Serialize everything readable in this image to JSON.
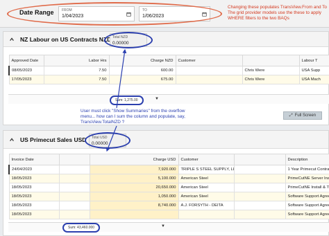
{
  "date_range": {
    "title": "Date Range",
    "from": {
      "label": "FROM",
      "value": "1/04/2023"
    },
    "to": {
      "label": "TO",
      "value": "1/06/2023"
    }
  },
  "annotations": {
    "red_note": "Changing these populates TransView.From and To\nThe grid provider models use the these to apply WHERE filters to the two BAQs",
    "blue_note": "User must click \"Show Summaries\" from the overflow menu... how can I sum the column and populate, say, TransView.TotalNZD ?"
  },
  "panel1": {
    "title": "NZ Labour on US Contracts NZD",
    "total_label": "Total NZD",
    "total_value": "0.00000",
    "columns": [
      "Approved Date",
      "Labor Hrs",
      "Charge NZD",
      "Customer",
      "",
      "Labour T"
    ],
    "rows": [
      {
        "date": "08/05/2023",
        "hrs": "7.50",
        "charge": "600.00",
        "customer": "Chris Were",
        "labour": "USA Supp"
      },
      {
        "date": "17/05/2023",
        "hrs": "7.50",
        "charge": "675.00",
        "customer": "Chris Were",
        "labour": "USA Mach"
      }
    ],
    "sum_label": "Sum: 1,275.00",
    "fullscreen_label": "Full Screen"
  },
  "panel2": {
    "title": "US Primecut Sales USD",
    "total_label": "Total USD",
    "total_value": "0.00000",
    "columns": [
      "Invoice Date",
      "",
      "Charge USD",
      "Customer",
      "",
      "Description"
    ],
    "rows": [
      {
        "date": "24/04/2023",
        "charge": "7,920.000",
        "customer": "TRIPLE S STEEL SUPPLY, LLC",
        "desc": "1 Year Primecut Contract"
      },
      {
        "date": "18/05/2023",
        "charge": "5,100.000",
        "customer": "American Steel",
        "desc": "PrimeCutNE Server Install"
      },
      {
        "date": "18/05/2023",
        "charge": "20,650.000",
        "customer": "American Steel",
        "desc": "PrimeCutNE Install & Train"
      },
      {
        "date": "18/05/2023",
        "charge": "1,050.000",
        "customer": "American Steel",
        "desc": "Software Support Agreem"
      },
      {
        "date": "18/05/2023",
        "charge": "8,740.000",
        "customer": "A.J. FORSYTH - DEITA",
        "desc": "Software Support Agreem"
      },
      {
        "date": "18/05/2023",
        "charge": "",
        "customer": "",
        "desc": "Software Support Agreem"
      }
    ],
    "sum_label": "Sum: 43,460.000"
  },
  "icons": {
    "calendar": "calendar-icon",
    "chevron": "chevron-up-icon",
    "caret": "caret-down-icon",
    "fullscreen": "fullscreen-icon"
  },
  "colors": {
    "red_annotation": "#d43a20",
    "blue_annotation": "#2a3fb0",
    "highlight_column": "#fff1c8"
  }
}
